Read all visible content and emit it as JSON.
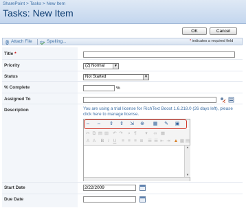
{
  "breadcrumb": [
    "SharePoint",
    "Tasks",
    "New Item"
  ],
  "breadcrumb_sep": ">",
  "page_title": "Tasks: New Item",
  "buttons": {
    "ok": "OK",
    "cancel": "Cancel"
  },
  "toolbar": {
    "attach_file": "Attach File",
    "spelling": "Spelling...",
    "required_note": "indicates a required field",
    "required_marker": "*"
  },
  "fields": {
    "title": {
      "label": "Title",
      "value": ""
    },
    "priority": {
      "label": "Priority",
      "value": "(2) Normal"
    },
    "status": {
      "label": "Status",
      "value": "Not Started"
    },
    "percent_complete": {
      "label": "% Complete",
      "value": "",
      "suffix": "%"
    },
    "assigned_to": {
      "label": "Assigned To",
      "value": ""
    },
    "description": {
      "label": "Description",
      "trial_notice": "You are using a trial license for RichText Boost 1.6.218.0 (26 days left), please click here to manage license."
    },
    "start_date": {
      "label": "Start Date",
      "value": "2/22/2009"
    },
    "due_date": {
      "label": "Due Date",
      "value": ""
    }
  },
  "colors": {
    "header_bg": "#c3d6ee",
    "title_text": "#0b3b70",
    "link_text": "#3b6ea5",
    "required_star": "#cc0000",
    "highlight_border": "#d23a2c"
  },
  "icons": {
    "toolbar_row1": [
      "ltr-icon",
      "rtl-icon",
      "insert-row-icon",
      "insert-column-icon",
      "merge-cells-icon",
      "split-cells-icon",
      "table-icon",
      "edit-icon",
      "image-icon"
    ],
    "toolbar_row2": [
      "cut-icon",
      "copy-icon",
      "paste-icon",
      "paste-text-icon",
      "undo-icon",
      "redo-icon",
      "find-icon",
      "format-icon",
      "style-icon",
      "hyperlink-icon",
      "insert-table-icon"
    ],
    "toolbar_row3": [
      "font-size-icon",
      "font-color-icon",
      "bold-icon",
      "italic-icon",
      "underline-icon",
      "align-left-icon",
      "align-center-icon",
      "align-right-icon",
      "justify-icon",
      "numbered-list-icon",
      "bullet-list-icon",
      "outdent-icon",
      "indent-icon",
      "text-color-icon",
      "highlight-icon",
      "html-icon"
    ]
  }
}
